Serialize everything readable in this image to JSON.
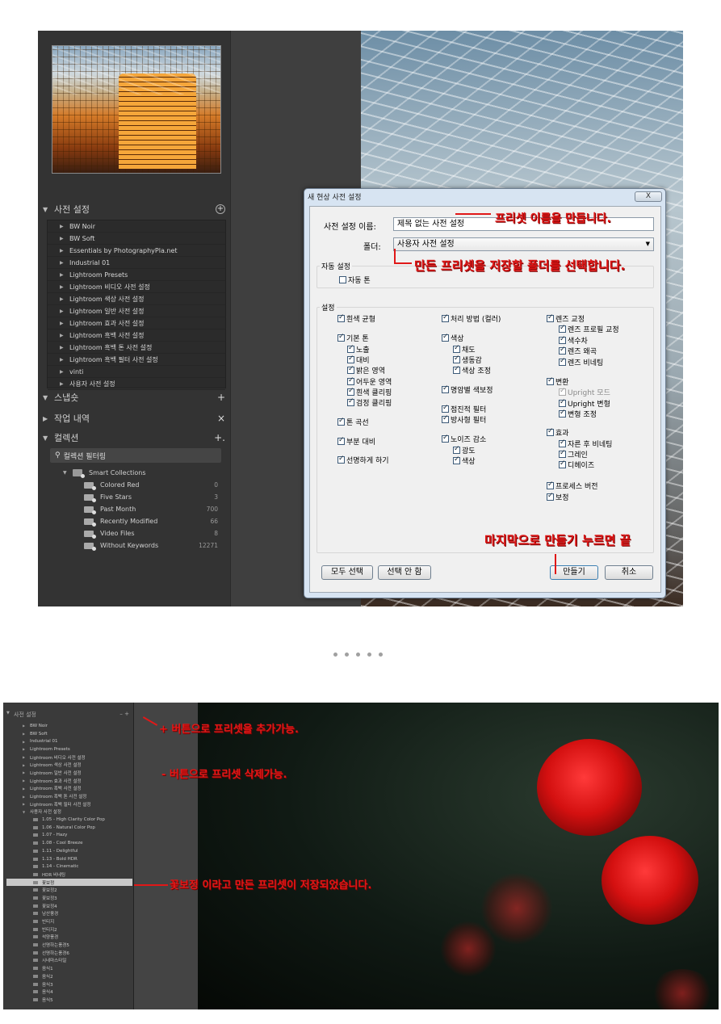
{
  "lightroom": {
    "presets_panel": {
      "title": "사전 설정",
      "add_label": "+",
      "items": [
        "BW Noir",
        "BW Soft",
        "Essentials by PhotographyPla.net",
        "Industrial 01",
        "Lightroom Presets",
        "Lightroom 비디오 사전 설정",
        "Lightroom 색상 사전 설정",
        "Lightroom 일반 사전 설정",
        "Lightroom 효과 사전 설정",
        "Lightroom 흑백 사전 설정",
        "Lightroom 흑백 톤 사전 설정",
        "Lightroom 흑백 필터 사전 설정",
        "vinti",
        "사용자 사전 설정"
      ]
    },
    "snapshot_panel": {
      "title": "스냅숏",
      "add_label": "+"
    },
    "history_panel": {
      "title": "작업 내역",
      "close_label": "×"
    },
    "collections_panel": {
      "title": "컬렉션",
      "add_label": "+.",
      "filter_label": "컬렉션 필터링",
      "smart_collections_label": "Smart Collections",
      "items": [
        {
          "name": "Colored Red",
          "count": "0"
        },
        {
          "name": "Five Stars",
          "count": "3"
        },
        {
          "name": "Past Month",
          "count": "700"
        },
        {
          "name": "Recently Modified",
          "count": "66"
        },
        {
          "name": "Video Files",
          "count": "8"
        },
        {
          "name": "Without Keywords",
          "count": "12271"
        }
      ]
    }
  },
  "dialog": {
    "title": "새 현상 사전 설정",
    "close_label": "X",
    "name_label": "사전 설정 이름:",
    "name_value": "제목 없는 사전 설정",
    "folder_label": "폴더:",
    "folder_value": "사용자 사전 설정",
    "auto_group_title": "자동 설정",
    "auto_tone_label": "자동 톤",
    "settings_group_title": "설정",
    "col1": {
      "white_balance": "흰색 균형",
      "basic_tone": "기본 톤",
      "exposure": "노출",
      "contrast": "대비",
      "highlights": "밝은 영역",
      "shadows": "어두운 영역",
      "white_clipping": "흰색 클리핑",
      "black_clipping": "검정 클리핑",
      "tone_curve": "톤 곡선",
      "clarity": "부분 대비",
      "sharpening": "선명하게 하기"
    },
    "col2": {
      "process": "처리 방법 (컬러)",
      "color": "색상",
      "saturation": "채도",
      "vibrance": "생동감",
      "color_adjust": "색상 조정",
      "split_toning": "명암별 색보정",
      "graduated_filter": "점진적 필터",
      "radial_filter": "방사형 필터",
      "noise_reduction": "노이즈 감소",
      "luminance": "광도",
      "noise_color": "색상"
    },
    "col3": {
      "lens_corrections": "렌즈 교정",
      "lens_profile": "렌즈 프로필 교정",
      "chromatic": "색수차",
      "distortion": "렌즈 왜곡",
      "vignetting": "렌즈 비네팅",
      "transform": "변환",
      "upright_mode": "Upright 모드",
      "upright_transforms": "Upright 변형",
      "transform_adjust": "변형 조정",
      "effects": "효과",
      "post_crop_vignette": "자른 후 비네팅",
      "grain": "그레인",
      "dehaze": "디헤이즈",
      "process_version": "프로세스 버전",
      "calibration": "보정"
    },
    "select_all_label": "모두 선택",
    "select_none_label": "선택 안 함",
    "create_label": "만들기",
    "cancel_label": "취소"
  },
  "annotations": {
    "name_note": "프리셋 이름을 만듭니다.",
    "folder_note": "만든 프리셋을 저장할 폴더를 선택합니다.",
    "create_note": "마지막으로 만들기 누르면 끝"
  },
  "panel2": {
    "title": "사전 설정",
    "buttons": "– +",
    "items": [
      {
        "label": "BW Noir",
        "type": "folder"
      },
      {
        "label": "BW Soft",
        "type": "folder"
      },
      {
        "label": "Industrial 01",
        "type": "folder"
      },
      {
        "label": "Lightroom Presets",
        "type": "folder"
      },
      {
        "label": "Lightroom 비디오 사전 설정",
        "type": "folder"
      },
      {
        "label": "Lightroom 색상 사전 설정",
        "type": "folder"
      },
      {
        "label": "Lightroom 일반 사전 설정",
        "type": "folder"
      },
      {
        "label": "Lightroom 효과 사전 설정",
        "type": "folder"
      },
      {
        "label": "Lightroom 흑백 사전 설정",
        "type": "folder"
      },
      {
        "label": "Lightroom 흑백 톤 사전 설정",
        "type": "folder"
      },
      {
        "label": "Lightroom 흑백 필터 사전 설정",
        "type": "folder"
      },
      {
        "label": "사용자 사전 설정",
        "type": "open"
      },
      {
        "label": "1.05 - High Clarity Color Pop",
        "type": "preset"
      },
      {
        "label": "1.06 - Natural Color Pop",
        "type": "preset"
      },
      {
        "label": "1.07 - Hazy",
        "type": "preset"
      },
      {
        "label": "1.08 - Cool Breeze",
        "type": "preset"
      },
      {
        "label": "1.11 - Delightful",
        "type": "preset"
      },
      {
        "label": "1.13 - Bold HDR",
        "type": "preset"
      },
      {
        "label": "1.14 - Cinematic",
        "type": "preset"
      },
      {
        "label": "HDR 비네팅",
        "type": "preset"
      },
      {
        "label": "꽃보정",
        "type": "selected"
      },
      {
        "label": "꽃보정2",
        "type": "preset"
      },
      {
        "label": "꽃보정3",
        "type": "preset"
      },
      {
        "label": "꽃보정4",
        "type": "preset"
      },
      {
        "label": "남산풍경",
        "type": "preset"
      },
      {
        "label": "빈티지",
        "type": "preset"
      },
      {
        "label": "빈티지2",
        "type": "preset"
      },
      {
        "label": "석양풍경",
        "type": "preset"
      },
      {
        "label": "선명하는풍경5",
        "type": "preset"
      },
      {
        "label": "선명하는풍경6",
        "type": "preset"
      },
      {
        "label": "시네마스타일",
        "type": "preset"
      },
      {
        "label": "음식1",
        "type": "preset"
      },
      {
        "label": "음식2",
        "type": "preset"
      },
      {
        "label": "음식3",
        "type": "preset"
      },
      {
        "label": "음식4",
        "type": "preset"
      },
      {
        "label": "음식5",
        "type": "preset"
      }
    ],
    "notes": {
      "add": "+ 버튼으로 프리셋을 추가가능.",
      "remove": "- 버튼으로 프리셋 삭제가능.",
      "saved": "꽃보정 이라고 만든 프리셋이 저장되었습니다."
    }
  },
  "colors": {
    "annotation": "#e01818",
    "dialog_frame": "#d7e4f2",
    "lr_panel": "#333333"
  }
}
